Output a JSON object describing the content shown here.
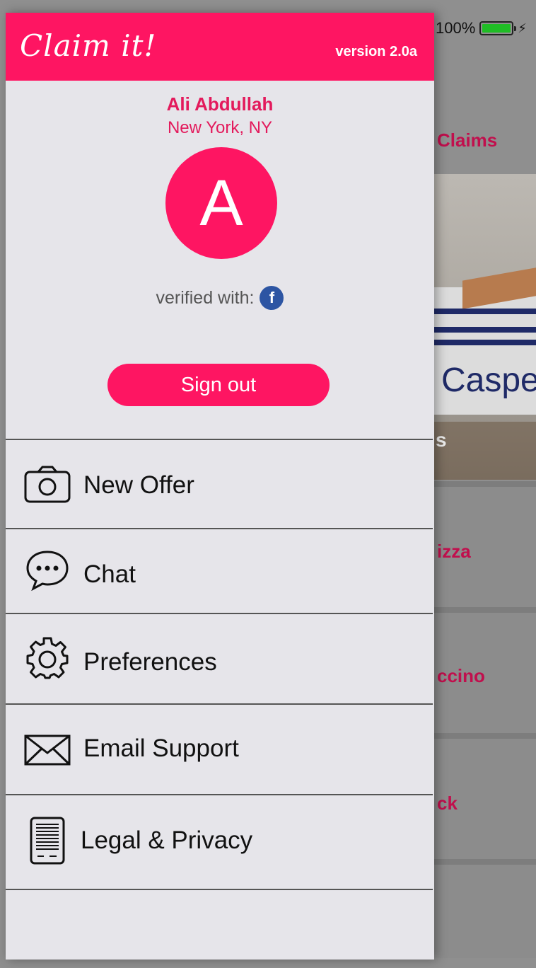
{
  "app": {
    "logo_text": "Claim it!",
    "version": "version 2.0a",
    "brand_color": "#fe1562"
  },
  "status_bar": {
    "battery_pct": "100%",
    "battery_level": 1.0
  },
  "background_screen": {
    "tab_fragment": "Claims",
    "banner_word_fragment": "Caspe",
    "banner_caption_fragment": "s",
    "rows": [
      "izza",
      "ccino",
      "ck"
    ]
  },
  "profile": {
    "name": "Ali Abdullah",
    "location": "New York, NY",
    "avatar_letter": "A",
    "verified_label": "verified with:",
    "verified_provider_icon": "facebook-icon",
    "verified_provider_glyph": "f"
  },
  "actions": {
    "sign_out": "Sign out"
  },
  "menu": {
    "items": [
      {
        "label": "New Offer",
        "icon": "camera-icon"
      },
      {
        "label": "Chat",
        "icon": "chat-bubble-icon"
      },
      {
        "label": "Preferences",
        "icon": "gear-icon"
      },
      {
        "label": "Email Support",
        "icon": "envelope-icon"
      },
      {
        "label": "Legal & Privacy",
        "icon": "document-icon"
      }
    ]
  }
}
